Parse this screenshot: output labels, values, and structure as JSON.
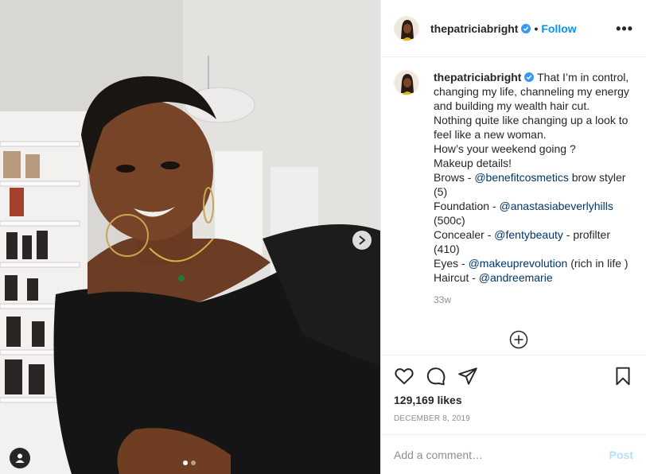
{
  "post": {
    "username": "thepatriciabright",
    "follow_label": "Follow",
    "more_label": "•••",
    "dot_sep": "•",
    "caption_intro": "That I’m in control, changing my life, channeling my energy and building my wealth hair cut.",
    "caption_lines": [
      {
        "text": "Nothing quite like changing up a look to feel like a new woman."
      },
      {
        "text": "How’s your weekend going ?"
      },
      {
        "text": "Makeup details!"
      },
      {
        "pre": "Brows - ",
        "mention": "@benefitcosmetics",
        "post": " brow styler (5)"
      },
      {
        "pre": "Foundation - ",
        "mention": "@anastasiabeverlyhills",
        "post": " (500c)"
      },
      {
        "pre": "Concealer - ",
        "mention": "@fentybeauty",
        "post": " - profilter (410)"
      },
      {
        "pre": "Eyes - ",
        "mention": "@makeuprevolution",
        "post": " (rich in life )"
      },
      {
        "pre": "Haircut - ",
        "mention": "@andreemarie",
        "post": ""
      }
    ],
    "age": "33w",
    "likes": "129,169 likes",
    "date": "DECEMBER 8, 2019",
    "comment_placeholder": "Add a comment…",
    "post_label": "Post"
  },
  "icons": {
    "verified": "verified-badge-icon",
    "like": "heart-icon",
    "comment": "comment-icon",
    "share": "paper-plane-icon",
    "save": "bookmark-icon",
    "add": "plus-circle-icon",
    "next": "chevron-right-icon",
    "tags": "user-tag-icon"
  },
  "colors": {
    "accent": "#0095f6",
    "mention": "#00376b",
    "muted": "#8e8e8e",
    "post_disabled": "#b2dffc"
  },
  "carousel": {
    "count": 2,
    "active_index": 0
  }
}
